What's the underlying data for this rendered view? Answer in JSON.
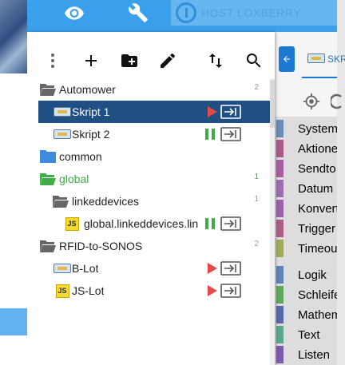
{
  "app": {
    "host_label": "HOST LOXBERRY"
  },
  "tree": {
    "rows": [
      {
        "label": "Automower",
        "count": "2"
      },
      {
        "label": "Skript 1"
      },
      {
        "label": "Skript 2"
      },
      {
        "label": "common"
      },
      {
        "label": "global",
        "count": "1"
      },
      {
        "label": "linkeddevices",
        "count": "1"
      },
      {
        "label": "global.linkeddevices.lin"
      },
      {
        "label": "RFID-to-SONOS",
        "count": "2"
      },
      {
        "label": "B-Lot"
      },
      {
        "label": "JS-Lot"
      }
    ]
  },
  "editor": {
    "tab_label": "SKR",
    "categories": [
      {
        "label": "System",
        "color": "#6a8bb5"
      },
      {
        "label": "Aktionen",
        "color": "#a75b86"
      },
      {
        "label": "Sendto",
        "color": "#a85e9b"
      },
      {
        "label": "Datum u",
        "color": "#9d6db0"
      },
      {
        "label": "Konverti",
        "color": "#9b62a7"
      },
      {
        "label": "Trigger",
        "color": "#a95e87"
      },
      {
        "label": "Timeouts",
        "color": "#a3a95c"
      },
      {
        "label": "Logik",
        "color": "#5d84b3"
      },
      {
        "label": "Schleife",
        "color": "#5da75b"
      },
      {
        "label": "Mathem",
        "color": "#5b67a6"
      },
      {
        "label": "Text",
        "color": "#5ba68c"
      },
      {
        "label": "Listen",
        "color": "#7c5ca8"
      }
    ]
  },
  "colors": {
    "accent": "#3aa0ec",
    "selected_row": "#1f4f83",
    "play": "#e84a4a",
    "pause": "#3fae49",
    "folder_green": "#3fae49",
    "folder_blue": "#3d8bdc"
  }
}
